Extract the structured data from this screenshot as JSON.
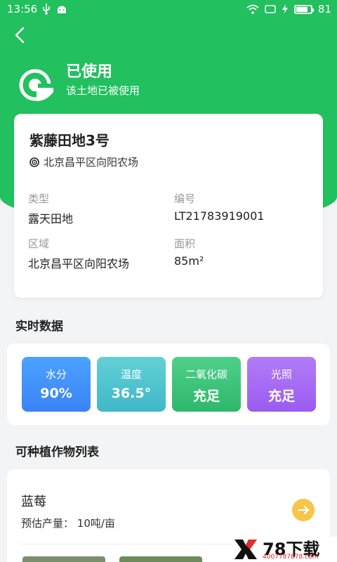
{
  "status_bar": {
    "time": "13:56",
    "battery": "81",
    "battery_level": 0.81
  },
  "header": {
    "status_title": "已使用",
    "status_subtitle": "该土地已被使用"
  },
  "land": {
    "name": "紫藤田地3号",
    "location": "北京昌平区向阳农场",
    "fields": [
      {
        "label": "类型",
        "value": "露天田地"
      },
      {
        "label": "编号",
        "value": "LT21783919001"
      },
      {
        "label": "区域",
        "value": "北京昌平区向阳农场"
      },
      {
        "label": "面积",
        "value": "85m²"
      }
    ]
  },
  "realtime": {
    "title": "实时数据",
    "tiles": [
      {
        "label": "水分",
        "value": "90%",
        "color_top": "#4aa3ff",
        "color_bottom": "#3b82f6"
      },
      {
        "label": "温度",
        "value": "36.5°",
        "color_top": "#63d0d6",
        "color_bottom": "#3fb8c8"
      },
      {
        "label": "二氧化碳",
        "value": "充足",
        "color_top": "#4fd08a",
        "color_bottom": "#2eb86b"
      },
      {
        "label": "光照",
        "value": "充足",
        "color_top": "#b27cf7",
        "color_bottom": "#9a5cf0"
      }
    ]
  },
  "crops": {
    "title": "可种植作物列表",
    "items": [
      {
        "name": "蓝莓",
        "yield_label": "预估产量：",
        "yield_value": "10吨/亩"
      }
    ]
  },
  "watermark": {
    "brand": "78下载",
    "url": "4007787878.com"
  },
  "colors": {
    "primary": "#22c05e",
    "accent": "#f7c547"
  }
}
